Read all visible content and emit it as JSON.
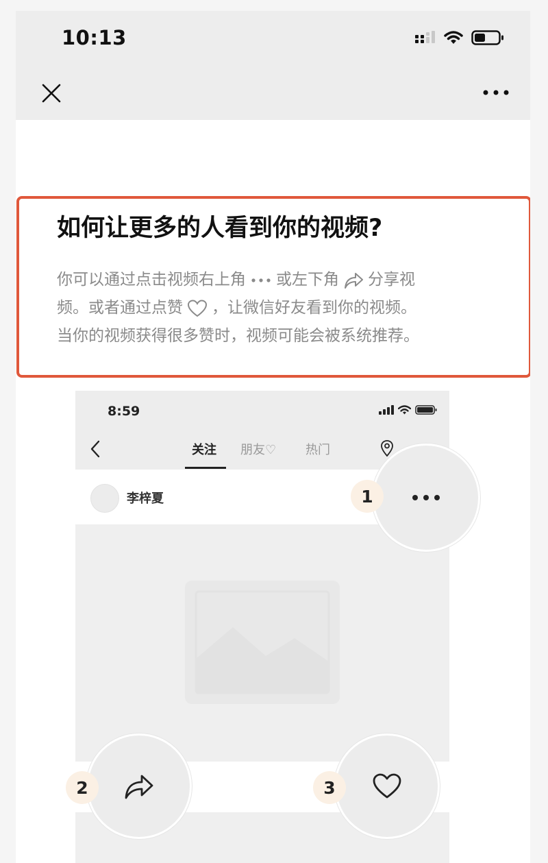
{
  "status_bar": {
    "time": "10:13"
  },
  "tip": {
    "title": "如何让更多的人看到你的视频?",
    "line1_a": "你可以通过点击视频右上角",
    "line1_b": "或左下角",
    "line1_c": "分享视",
    "line2_a": "频。或者通过点赞",
    "line2_b": "，让微信好友看到你的视频。",
    "line3": "当你的视频获得很多赞时，视频可能会被系统推荐。"
  },
  "mock_phone": {
    "time": "8:59",
    "tabs": [
      {
        "label": "关注",
        "active": true
      },
      {
        "label": "朋友♡",
        "active": false
      },
      {
        "label": "热门",
        "active": false
      }
    ],
    "username": "李梓夏"
  },
  "callouts": [
    {
      "number": "1",
      "icon": "more-dots-icon"
    },
    {
      "number": "2",
      "icon": "share-icon"
    },
    {
      "number": "3",
      "icon": "heart-icon"
    }
  ],
  "colors": {
    "highlight_border": "#e0583b",
    "badge_bg": "#fbf0e4",
    "bar_bg": "#ededed"
  }
}
